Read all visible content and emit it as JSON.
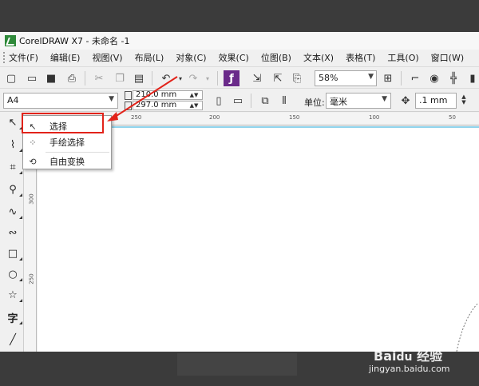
{
  "window": {
    "title": "CorelDRAW X7 - 未命名 -1"
  },
  "menubar": {
    "items": [
      "文件(F)",
      "编辑(E)",
      "视图(V)",
      "布局(L)",
      "对象(C)",
      "效果(C)",
      "位图(B)",
      "文本(X)",
      "表格(T)",
      "工具(O)",
      "窗口(W)"
    ]
  },
  "toolbar1": {
    "zoom_value": "58%"
  },
  "toolbar2": {
    "page_size": "A4",
    "width_value": "210.0 mm",
    "height_value": "297.0 mm",
    "unit_label": "单位:",
    "unit_value": "毫米",
    "nudge_value": ".1 mm"
  },
  "ruler": {
    "top_labels": [
      "250",
      "200",
      "150",
      "100",
      "50"
    ],
    "left_labels": [
      "300",
      "250"
    ]
  },
  "flyout": {
    "items": [
      {
        "label": "选择",
        "icon": "pick-arrow-icon"
      },
      {
        "label": "手绘选择",
        "icon": "freehand-pick-icon"
      },
      {
        "label": "自由变换",
        "icon": "free-transform-icon"
      }
    ]
  },
  "watermark": {
    "brand": "Bai",
    "brand_suffix": "经验",
    "url": "jingyan.baidu.com"
  },
  "colors": {
    "highlight": "#e2231a",
    "page_edge": "#8fd3ec"
  }
}
